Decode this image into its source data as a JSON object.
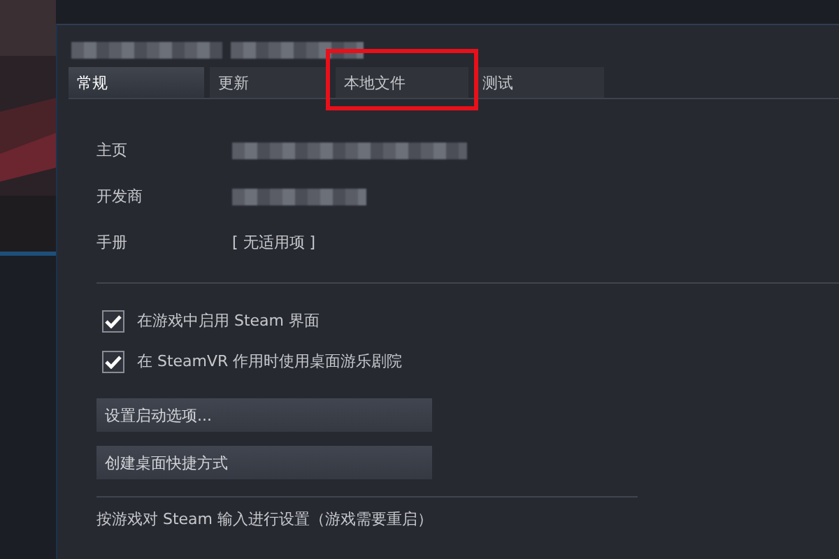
{
  "tabs": [
    {
      "label": "常规",
      "selected": true,
      "highlighted": false
    },
    {
      "label": "更新",
      "selected": false,
      "highlighted": false
    },
    {
      "label": "本地文件",
      "selected": false,
      "highlighted": true
    },
    {
      "label": "测试",
      "selected": false,
      "highlighted": false
    }
  ],
  "info": [
    {
      "label": "主页",
      "kind": "redacted"
    },
    {
      "label": "开发商",
      "kind": "redacted"
    },
    {
      "label": "手册",
      "kind": "text",
      "value": "[ 无适用项 ]"
    }
  ],
  "options": [
    {
      "label": "在游戏中启用 Steam 界面",
      "checked": true
    },
    {
      "label": "在 SteamVR 作用时使用桌面游乐剧院",
      "checked": true
    }
  ],
  "buttons": [
    "设置启动选项...",
    "创建桌面快捷方式"
  ],
  "footer_text": "按游戏对 Steam 输入进行设置（游戏需要重启）"
}
